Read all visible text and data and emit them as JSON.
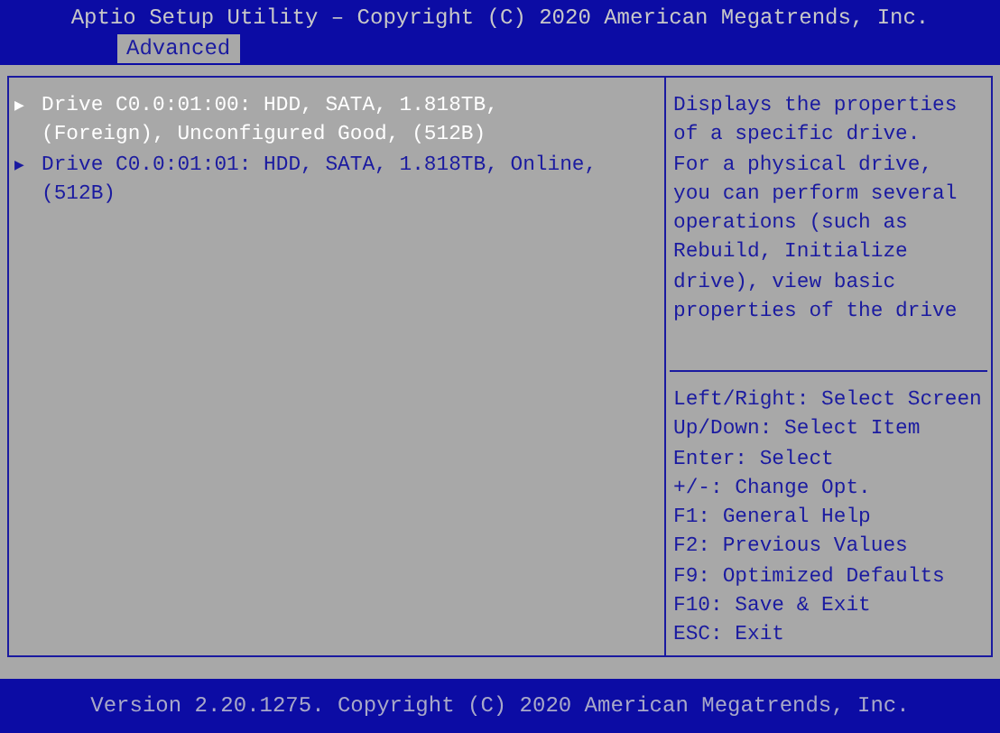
{
  "header": {
    "title": "Aptio Setup Utility – Copyright (C) 2020 American Megatrends, Inc.",
    "tabs": [
      {
        "label": "Advanced",
        "selected": true
      }
    ]
  },
  "items": [
    {
      "marker": "▶",
      "label": "Drive C0.0:01:00: HDD, SATA, 1.818TB, (Foreign), Unconfigured Good, (512B)",
      "selected": true
    },
    {
      "marker": "▶",
      "label": "Drive C0.0:01:01: HDD, SATA, 1.818TB, Online, (512B)",
      "selected": false
    }
  ],
  "help": {
    "description_lines": [
      "Displays the properties",
      "of a specific drive.",
      "For a physical drive,",
      "you can perform several",
      "operations (such as",
      "Rebuild, Initialize",
      "drive), view basic",
      "properties of the drive"
    ],
    "keys": [
      "Left/Right: Select Screen",
      "Up/Down: Select Item",
      "Enter: Select",
      "+/-: Change Opt.",
      "F1: General Help",
      "F2: Previous Values",
      "F9: Optimized Defaults",
      "F10: Save & Exit",
      "ESC: Exit"
    ]
  },
  "footer": "Version 2.20.1275. Copyright (C) 2020 American Megatrends, Inc."
}
